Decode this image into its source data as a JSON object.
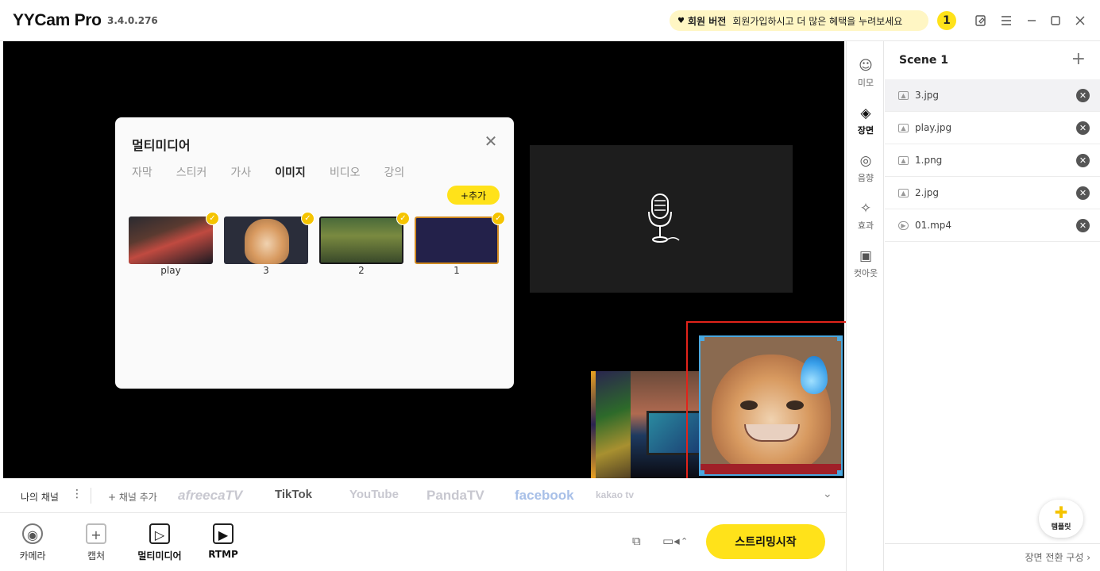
{
  "app": {
    "name": "YYCam Pro",
    "version": "3.4.0.276",
    "member_label": "회원 버전",
    "member_text": "회원가입하시고 더 많은 혜택을 누려보세요",
    "notification_count": "1"
  },
  "dialog": {
    "title": "멀티미디어",
    "tabs": [
      "자막",
      "스티커",
      "가사",
      "이미지",
      "비디오",
      "강의"
    ],
    "active_tab": "이미지",
    "add_label": "+추가",
    "items": [
      {
        "label": "play"
      },
      {
        "label": "3"
      },
      {
        "label": "2"
      },
      {
        "label": "1"
      }
    ]
  },
  "right_tools": [
    {
      "label": "미모",
      "icon": "face-icon"
    },
    {
      "label": "장면",
      "icon": "layers-icon"
    },
    {
      "label": "음향",
      "icon": "audio-wave-icon"
    },
    {
      "label": "효과",
      "icon": "magic-wand-icon"
    },
    {
      "label": "컷아웃",
      "icon": "cutout-icon"
    }
  ],
  "scene": {
    "title": "Scene 1",
    "items": [
      {
        "name": "3.jpg",
        "type": "image"
      },
      {
        "name": "play.jpg",
        "type": "image"
      },
      {
        "name": "1.png",
        "type": "image"
      },
      {
        "name": "2.jpg",
        "type": "image"
      },
      {
        "name": "01.mp4",
        "type": "video"
      }
    ],
    "template_label": "템플릿",
    "footer_label": "장면 전환 구성 ›"
  },
  "channels": {
    "my_channel": "나의 채널",
    "add_channel": "+ 채널 추가",
    "brands": [
      "afreecaTV",
      "TikTok",
      "YouTube",
      "PandaTV",
      "facebook",
      "kakao tv"
    ]
  },
  "bottom": {
    "camera": "카메라",
    "capture": "캡처",
    "multimedia": "멀티미디어",
    "rtmp": "RTMP",
    "stream_label": "스트리밍시작"
  },
  "colors": {
    "accent": "#ffe21a",
    "selection_border": "#4aa8e0",
    "highlight_red": "#e2231a"
  }
}
